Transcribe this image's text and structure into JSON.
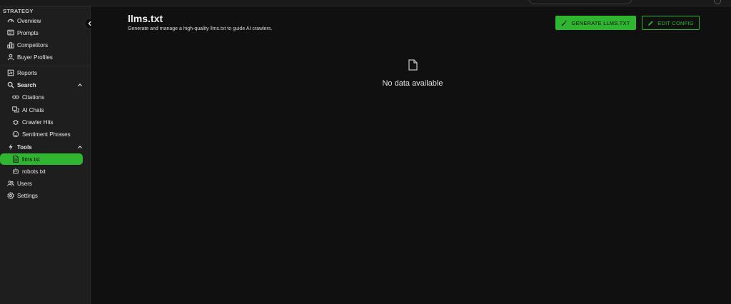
{
  "sidebar": {
    "section_label": "STRATEGY",
    "items": [
      {
        "label": "Overview",
        "icon": "dashboard-icon"
      },
      {
        "label": "Prompts",
        "icon": "prompts-icon"
      },
      {
        "label": "Competitors",
        "icon": "competitors-icon"
      },
      {
        "label": "Buyer Profiles",
        "icon": "person-icon"
      },
      {
        "label": "Reports",
        "icon": "reports-icon"
      },
      {
        "label": "Search",
        "icon": "search-icon",
        "expanded": true
      },
      {
        "label": "Citations",
        "icon": "link-icon"
      },
      {
        "label": "AI Chats",
        "icon": "chat-icon"
      },
      {
        "label": "Crawler Hits",
        "icon": "bug-icon"
      },
      {
        "label": "Sentiment Phrases",
        "icon": "smile-icon"
      },
      {
        "label": "Tools",
        "icon": "bolt-icon",
        "expanded": true
      },
      {
        "label": "llms.txt",
        "icon": "file-icon",
        "active": true
      },
      {
        "label": "robots.txt",
        "icon": "robot-icon"
      },
      {
        "label": "Users",
        "icon": "users-icon"
      },
      {
        "label": "Settings",
        "icon": "gear-icon"
      }
    ]
  },
  "header": {
    "title": "llms.txt",
    "subtitle": "Generate and manage a high-quality llms.txt to guide AI crawlers.",
    "generate_label": "GENERATE LLMS.TXT",
    "edit_label": "EDIT CONFIG"
  },
  "empty_state": {
    "icon": "document-icon",
    "text": "No data available"
  },
  "colors": {
    "accent": "#2fb52f",
    "background": "#101010",
    "sidebar": "#1e1e1e"
  }
}
